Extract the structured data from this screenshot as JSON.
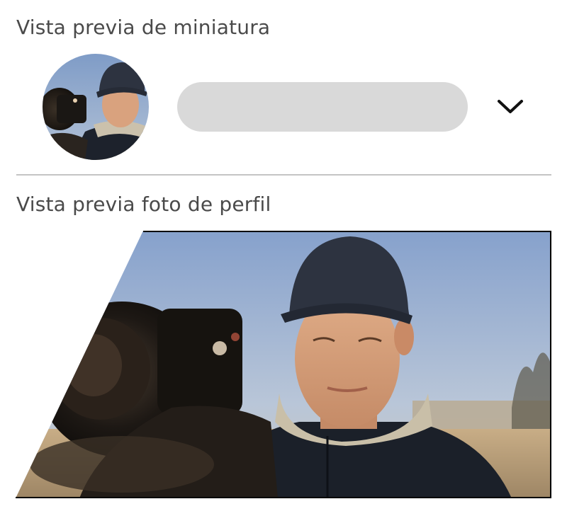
{
  "sections": {
    "thumbnail_title": "Vista previa de miniatura",
    "profile_title": "Vista previa foto de perfil"
  },
  "icons": {
    "dropdown": "chevron-down-icon"
  },
  "colors": {
    "pill": "#d9d9d9",
    "text": "#4a4a4a",
    "divider": "#c4c4c4"
  }
}
